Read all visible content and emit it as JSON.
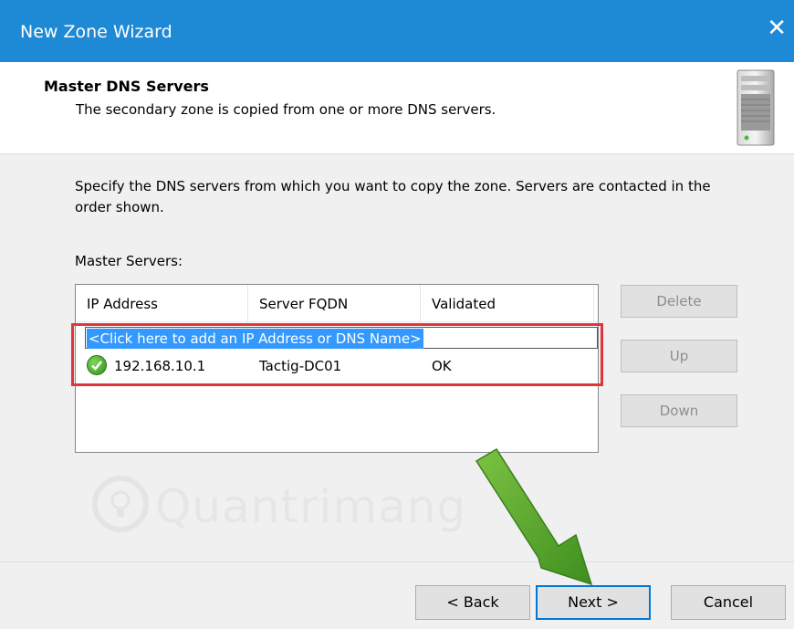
{
  "window": {
    "title": "New Zone Wizard",
    "close_symbol": "✕"
  },
  "header": {
    "title": "Master DNS Servers",
    "subtitle": "The secondary zone is copied from one or more DNS servers.",
    "icon": "server-tower-icon"
  },
  "body": {
    "instructions": "Specify the DNS servers from which you want to copy the zone.  Servers are contacted in the order shown.",
    "servers_label": "Master Servers:"
  },
  "list": {
    "columns": [
      "IP Address",
      "Server FQDN",
      "Validated"
    ],
    "add_prompt": "<Click here to add an IP Address or DNS Name>",
    "rows": [
      {
        "ip": "192.168.10.1",
        "fqdn": "Tactig-DC01",
        "validated": "OK",
        "status_icon": "check-circle-icon"
      }
    ]
  },
  "side_buttons": {
    "delete": "Delete",
    "up": "Up",
    "down": "Down"
  },
  "footer": {
    "back": "< Back",
    "next": "Next >",
    "cancel": "Cancel"
  },
  "watermark": {
    "text": "Quantrimang"
  },
  "colors": {
    "titlebar": "#1e8ad6",
    "highlight_border": "#e0363a",
    "arrow": "#5aa02c",
    "selection": "#3399ff"
  }
}
